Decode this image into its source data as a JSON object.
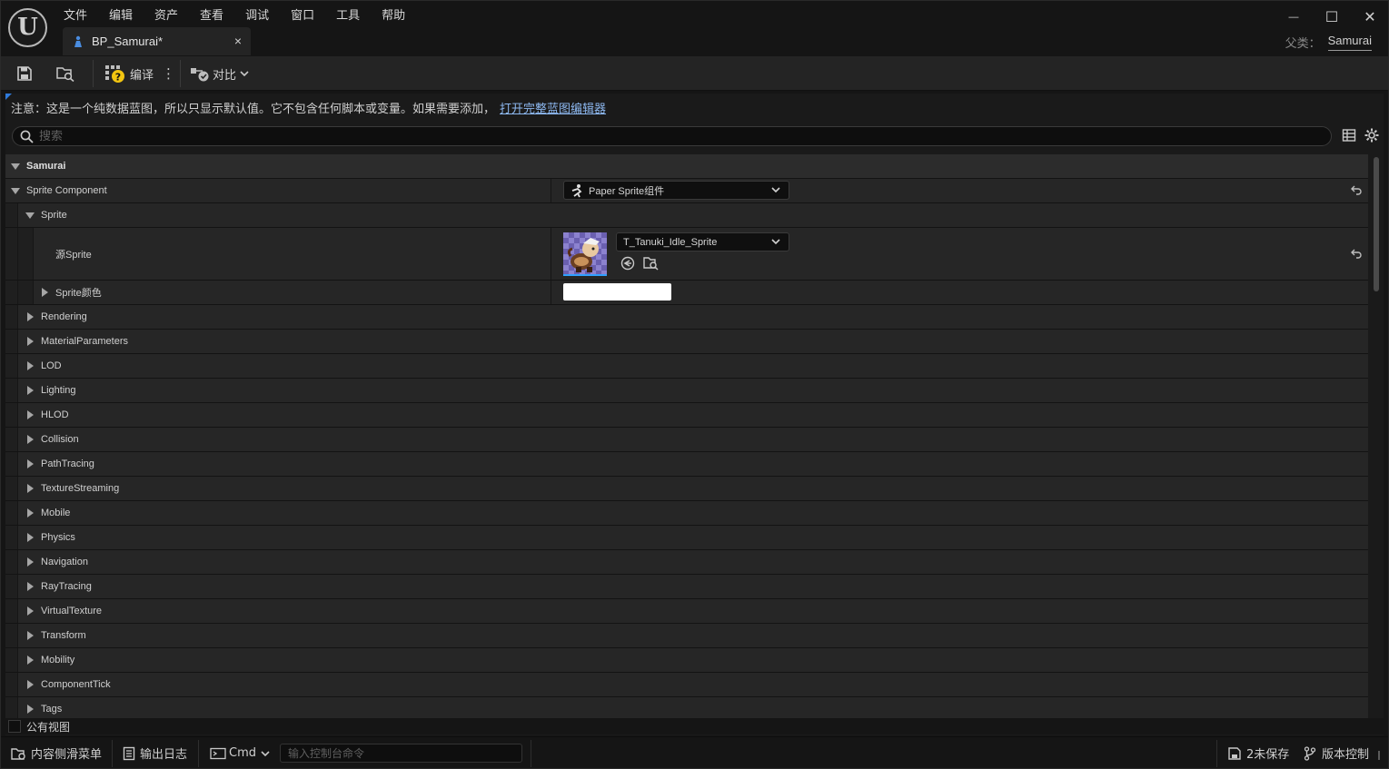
{
  "app": {
    "logo_glyph": "U",
    "menu": [
      "文件",
      "编辑",
      "资产",
      "查看",
      "调试",
      "窗口",
      "工具",
      "帮助"
    ],
    "tab": {
      "label": "BP_Samurai*",
      "close": "×"
    },
    "window_controls": {
      "minimize": "—",
      "maximize": "☐",
      "close": "✕"
    },
    "parent_class": {
      "label": "父类：",
      "value": "Samurai"
    }
  },
  "toolbar": {
    "compile_label": "编译",
    "diff_label": "对比",
    "more_glyph": "⋮"
  },
  "notice": {
    "text": "注意：这是一个纯数据蓝图，所以只显示默认值。它不包含任何脚本或变量。如果需要添加，",
    "link": "打开完整蓝图编辑器"
  },
  "search": {
    "placeholder": "搜索"
  },
  "details": {
    "root_category": "Samurai",
    "sprite_component": {
      "label": "Sprite Component",
      "value": "Paper Sprite组件"
    },
    "sprite_group": "Sprite",
    "source_sprite": {
      "label": "源Sprite",
      "value": "T_Tanuki_Idle_Sprite"
    },
    "sprite_color": {
      "label": "Sprite颜色"
    },
    "categories": [
      "Rendering",
      "MaterialParameters",
      "LOD",
      "Lighting",
      "HLOD",
      "Collision",
      "PathTracing",
      "TextureStreaming",
      "Mobile",
      "Physics",
      "Navigation",
      "RayTracing",
      "VirtualTexture",
      "Transform",
      "Mobility",
      "ComponentTick",
      "Tags"
    ]
  },
  "public_view": "公有视图",
  "statusbar": {
    "content_drawer": "内容侧滑菜单",
    "output_log": "输出日志",
    "cmd": "Cmd",
    "console_placeholder": "输入控制台命令",
    "unsaved": "2未保存",
    "source_control": "版本控制"
  },
  "colors": {
    "accent_blue": "#2f7bdb",
    "link_blue": "#8db8f0",
    "compile_yellow": "#f2c511"
  }
}
